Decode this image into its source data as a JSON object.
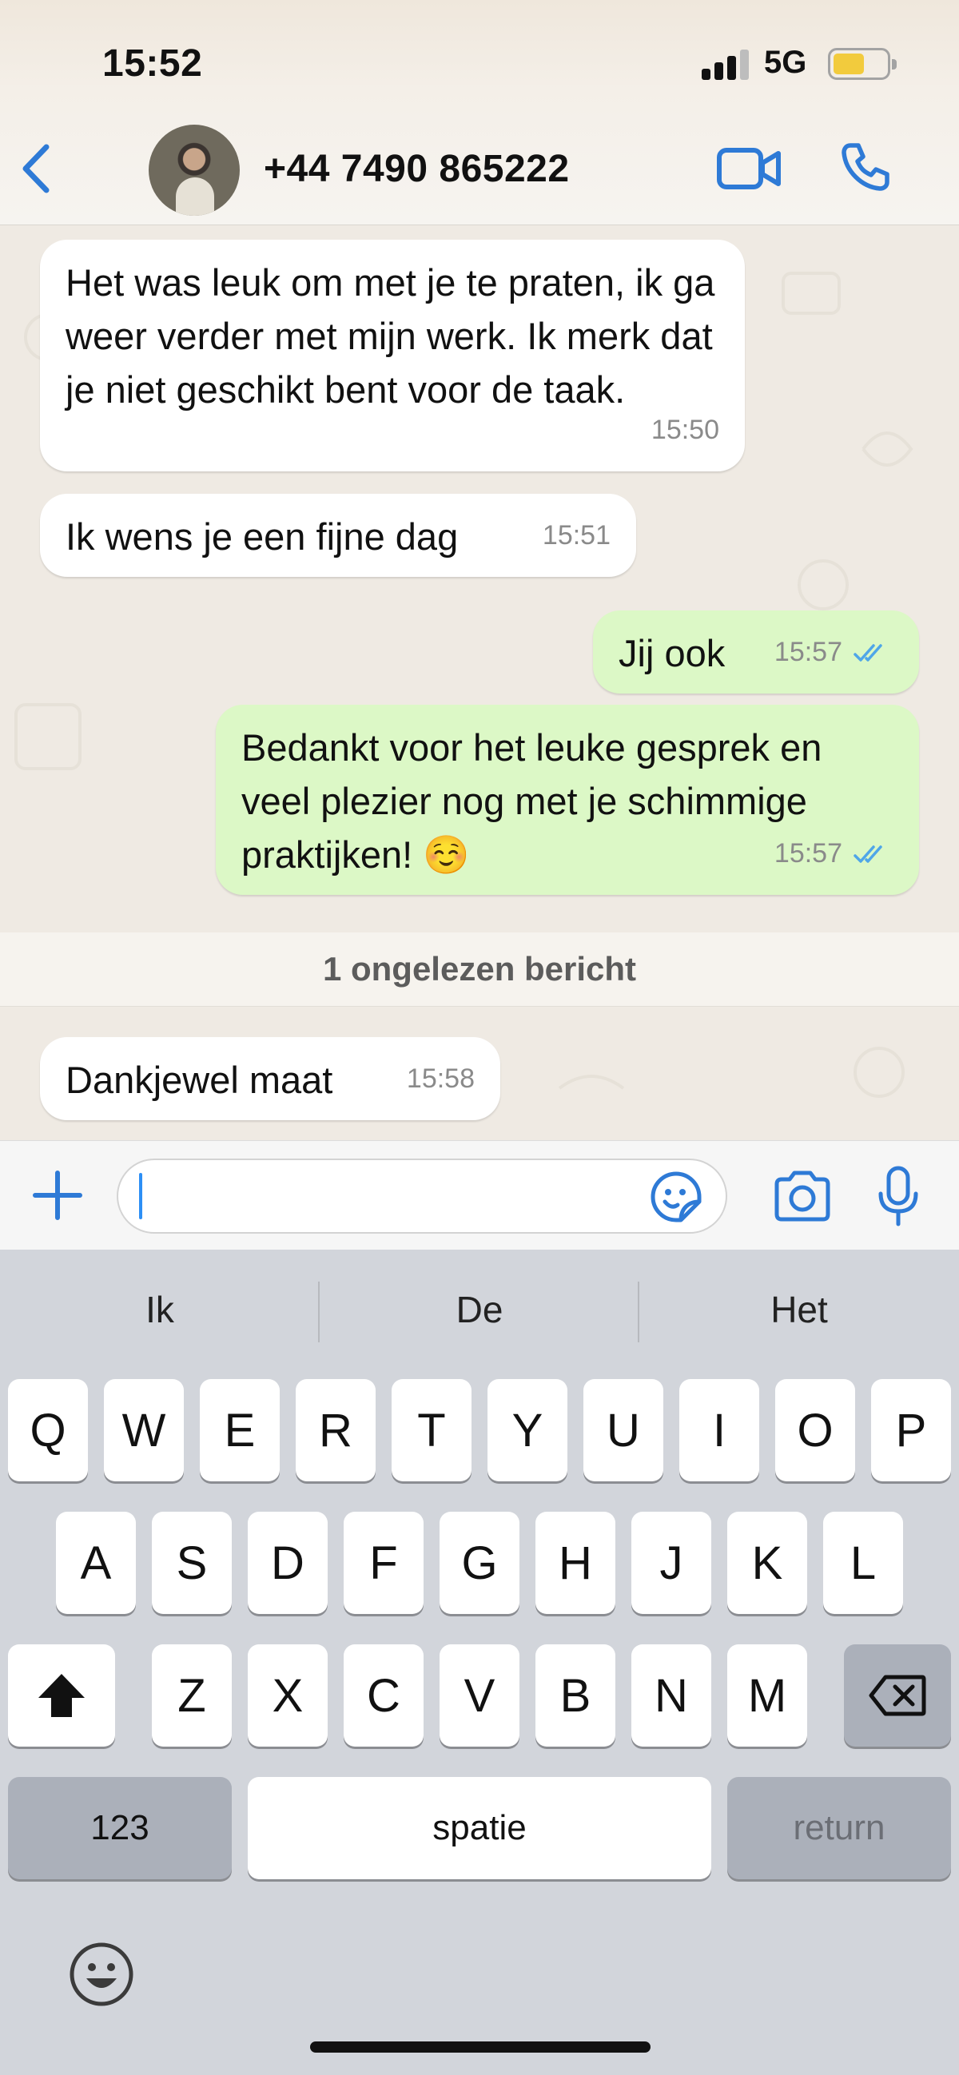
{
  "status_bar": {
    "time": "15:52",
    "network": "5G"
  },
  "header": {
    "contact_name": "+44 7490 865222"
  },
  "messages": [
    {
      "direction": "in",
      "text": "Het was leuk om met je te praten, ik ga weer verder met mijn werk. Ik merk dat je niet geschikt bent voor de taak.",
      "time": "15:50"
    },
    {
      "direction": "in",
      "text": "Ik wens je een fijne dag",
      "time": "15:51"
    },
    {
      "direction": "out",
      "text": "Jij ook",
      "time": "15:57",
      "read": true
    },
    {
      "direction": "out",
      "text": "Bedankt voor het leuke gesprek en veel plezier nog met je schimmige praktijken! ☺️",
      "time": "15:57",
      "read": true
    },
    {
      "direction": "in",
      "text": "Dankjewel maat",
      "time": "15:58"
    }
  ],
  "unread_banner": "1 ongelezen bericht",
  "composer": {
    "value": "",
    "placeholder": ""
  },
  "keyboard": {
    "suggestions": [
      "Ik",
      "De",
      "Het"
    ],
    "row1": [
      "Q",
      "W",
      "E",
      "R",
      "T",
      "Y",
      "U",
      "I",
      "O",
      "P"
    ],
    "row2": [
      "A",
      "S",
      "D",
      "F",
      "G",
      "H",
      "J",
      "K",
      "L"
    ],
    "row3": [
      "Z",
      "X",
      "C",
      "V",
      "B",
      "N",
      "M"
    ],
    "numbers_key": "123",
    "space_key": "spatie",
    "return_key": "return"
  },
  "icons": {
    "back": "chevron-left-icon",
    "video": "video-camera-icon",
    "call": "phone-icon",
    "attach": "plus-icon",
    "sticker": "sticker-icon",
    "camera": "camera-icon",
    "mic": "microphone-icon",
    "shift": "shift-arrow-icon",
    "delete": "backspace-icon",
    "emoji": "emoji-icon"
  },
  "colors": {
    "accent": "#2e7ad6",
    "outgoing_bubble": "#dcf8c6",
    "incoming_bubble": "#ffffff",
    "read_ticks": "#4fa6e8"
  }
}
